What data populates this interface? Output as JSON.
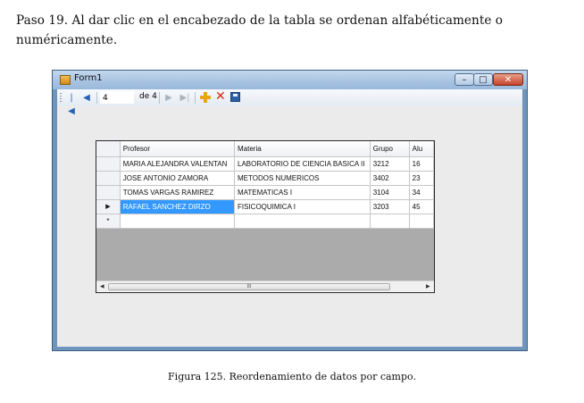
{
  "paragraph": {
    "line1": "Paso 19.  Al dar clic en el encabezado de la tabla se ordenan alfabéticamente o",
    "line2": "numéricamente."
  },
  "window": {
    "title": "Form1",
    "controls": {
      "minimize": "–",
      "maximize": "□",
      "close": "✕"
    }
  },
  "navigator": {
    "position": "4",
    "count_label": "de 4",
    "icons": [
      "move-first-icon",
      "move-previous-icon",
      "move-next-icon",
      "move-last-icon",
      "add-new-icon",
      "delete-icon",
      "save-icon"
    ]
  },
  "grid": {
    "columns": [
      "Profesor",
      "Materia",
      "Grupo",
      "Alu"
    ],
    "rows": [
      {
        "indicator": "",
        "cells": [
          "MARIA ALEJANDRA VALENTAN",
          "LABORATORIO DE CIENCIA BASICA II",
          "3212",
          "16"
        ]
      },
      {
        "indicator": "",
        "cells": [
          "JOSE ANTONIO ZAMORA",
          "METODOS NUMERICOS",
          "3402",
          "23"
        ]
      },
      {
        "indicator": "",
        "cells": [
          "TOMAS VARGAS RAMIREZ",
          "MATEMATICAS I",
          "3104",
          "34"
        ]
      },
      {
        "indicator": "▶",
        "cells": [
          "RAFAEL SANCHEZ DIRZO",
          "FISICOQUIMICA I",
          "3203",
          "45"
        ],
        "selected_cell": 0
      },
      {
        "indicator": "*",
        "cells": [
          "",
          "",
          "",
          ""
        ]
      }
    ],
    "scrollbar_thumb_label": "III"
  },
  "caption": "Figura 125. Reordenamiento de datos por campo."
}
